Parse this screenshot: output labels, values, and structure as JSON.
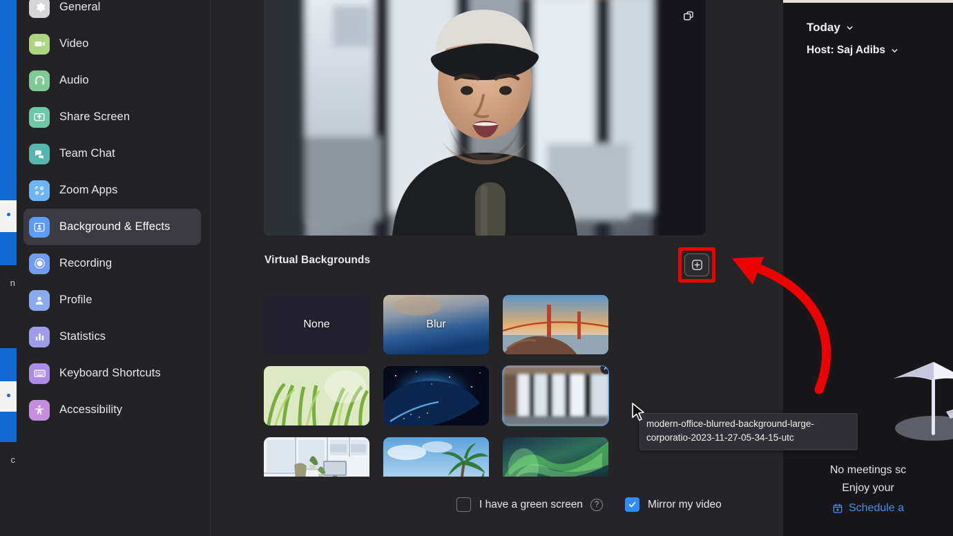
{
  "sidebar": {
    "items": [
      {
        "label": "General",
        "icon": "gear-icon",
        "color": "#d6d6d8",
        "active": false
      },
      {
        "label": "Video",
        "icon": "camera-icon",
        "color": "#aed581",
        "active": false
      },
      {
        "label": "Audio",
        "icon": "headset-icon",
        "color": "#81c995",
        "active": false
      },
      {
        "label": "Share Screen",
        "icon": "share-icon",
        "color": "#6fc7a8",
        "active": false
      },
      {
        "label": "Team Chat",
        "icon": "chat-icon",
        "color": "#54b6ac",
        "active": false
      },
      {
        "label": "Zoom Apps",
        "icon": "apps-icon",
        "color": "#6cb6f5",
        "active": false
      },
      {
        "label": "Background & Effects",
        "icon": "person-card-icon",
        "color": "#5b9cf7",
        "active": true
      },
      {
        "label": "Recording",
        "icon": "record-icon",
        "color": "#6f9cf0",
        "active": false
      },
      {
        "label": "Profile",
        "icon": "profile-icon",
        "color": "#8aaaf0",
        "active": false
      },
      {
        "label": "Statistics",
        "icon": "bars-icon",
        "color": "#9c9ce8",
        "active": false
      },
      {
        "label": "Keyboard Shortcuts",
        "icon": "keyboard-icon",
        "color": "#ab8de8",
        "active": false
      },
      {
        "label": "Accessibility",
        "icon": "accessibility-icon",
        "color": "#c58ddd",
        "active": false
      }
    ]
  },
  "main": {
    "preview_popout_icon": "popout-icon",
    "section_title": "Virtual Backgrounds",
    "add_button_icon": "plus-in-square-icon",
    "backgrounds": [
      {
        "name": "None",
        "type": "none",
        "label": "None",
        "selected": false,
        "removable": false
      },
      {
        "name": "Blur",
        "type": "blur",
        "label": "Blur",
        "selected": false,
        "removable": false
      },
      {
        "name": "Golden Gate Bridge",
        "type": "image",
        "label": "",
        "selected": false,
        "removable": false
      },
      {
        "name": "Grass",
        "type": "image",
        "label": "",
        "selected": false,
        "removable": false
      },
      {
        "name": "Earth from space",
        "type": "image",
        "label": "",
        "selected": false,
        "removable": false
      },
      {
        "name": "Modern office blurred",
        "type": "image",
        "label": "",
        "selected": true,
        "removable": true
      },
      {
        "name": "Office desk",
        "type": "image",
        "label": "",
        "selected": false,
        "removable": false
      },
      {
        "name": "Palm beach",
        "type": "image",
        "label": "",
        "selected": false,
        "removable": false
      },
      {
        "name": "Aurora",
        "type": "image",
        "label": "",
        "selected": false,
        "removable": false
      }
    ],
    "tooltip": "modern-office-blurred-background-large-corporatio-2023-11-27-05-34-15-utc",
    "green_screen_label": "I have a green screen",
    "green_screen_checked": false,
    "green_screen_help_icon": "question-mark-icon",
    "mirror_label": "Mirror my video",
    "mirror_checked": true
  },
  "right_panel": {
    "today_label": "Today",
    "today_chevron_icon": "chevron-down-icon",
    "host_label": "Host: Saj Adibs",
    "host_chevron_icon": "chevron-down-icon",
    "umbrella_icon": "beach-umbrella-illustration",
    "empty_line1": "No meetings sc",
    "empty_line2": "Enjoy your",
    "schedule_link": "Schedule a",
    "schedule_icon": "calendar-plus-icon"
  },
  "annotation": {
    "highlight_color": "#ef0000",
    "arrow_color": "#ef0000",
    "target": "add-background-button"
  }
}
